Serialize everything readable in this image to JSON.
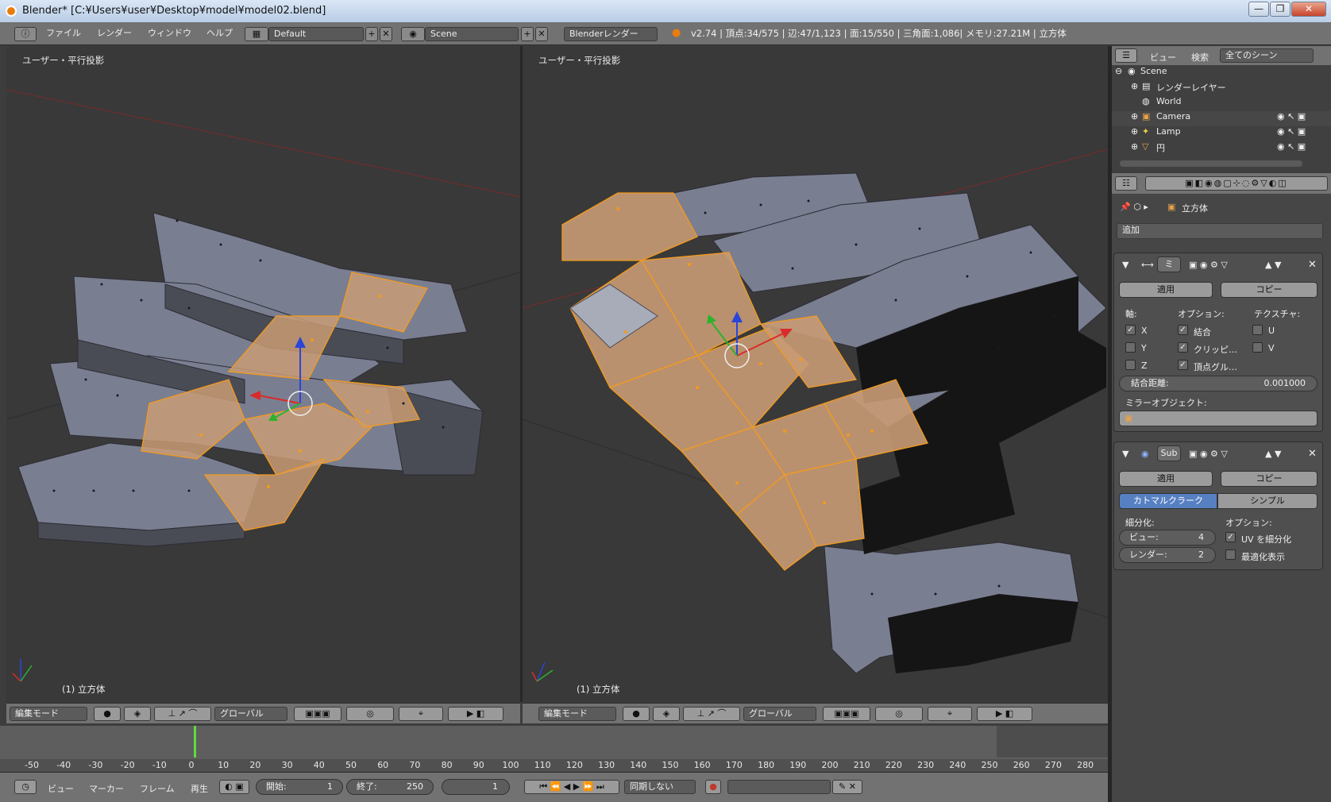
{
  "window": {
    "title": "Blender* [C:¥Users¥user¥Desktop¥model¥model02.blend]",
    "min": "—",
    "max": "❐",
    "close": "✕"
  },
  "info": {
    "menus": [
      "ファイル",
      "レンダー",
      "ウィンドウ",
      "ヘルプ"
    ],
    "layout": "Default",
    "scene": "Scene",
    "engine": "Blenderレンダー",
    "stats": "v2.74 | 頂点:34/575 | 辺:47/1,123 | 面:15/550 | 三角面:1,086| メモリ:27.21M | 立方体"
  },
  "viewport_left": {
    "label": "ユーザー・平行投影",
    "object": "(1) 立方体"
  },
  "viewport_right": {
    "label": "ユーザー・平行投影",
    "object": "(1) 立方体"
  },
  "view_header": {
    "mode": "編集モード",
    "orientation": "グローバル"
  },
  "outliner": {
    "menus": [
      "ビュー",
      "検索"
    ],
    "filter": "全てのシーン",
    "items": [
      {
        "name": "Scene",
        "icon": "scene-icon"
      },
      {
        "name": "レンダーレイヤー",
        "icon": "render-layers-icon"
      },
      {
        "name": "World",
        "icon": "world-icon"
      },
      {
        "name": "Camera",
        "icon": "camera-icon"
      },
      {
        "name": "Lamp",
        "icon": "lamp-icon"
      },
      {
        "name": "円",
        "icon": "mesh-icon"
      }
    ]
  },
  "properties": {
    "object_name": "立方体",
    "add_modifier": "追加",
    "mirror": {
      "name": "ミ",
      "apply": "適用",
      "copy": "コピー",
      "axis_label": "軸:",
      "options_label": "オプション:",
      "texture_label": "テクスチャ:",
      "axes": [
        {
          "label": "X",
          "checked": true
        },
        {
          "label": "Y",
          "checked": false
        },
        {
          "label": "Z",
          "checked": false
        }
      ],
      "options": [
        {
          "label": "結合",
          "checked": true
        },
        {
          "label": "クリッピ…",
          "checked": true
        },
        {
          "label": "頂点グル…",
          "checked": true
        }
      ],
      "textures": [
        {
          "label": "U",
          "checked": false
        },
        {
          "label": "V",
          "checked": false
        }
      ],
      "merge_label": "結合距離:",
      "merge_value": "0.001000",
      "mirror_object_label": "ミラーオブジェクト:"
    },
    "subsurf": {
      "name": "Sub",
      "apply": "適用",
      "copy": "コピー",
      "catmull": "カトマルクラーク",
      "simple": "シンプル",
      "subdiv_label": "細分化:",
      "options_label": "オプション:",
      "view_label": "ビュー:",
      "view_value": "4",
      "render_label": "レンダー:",
      "render_value": "2",
      "uv_label": "UV を細分化",
      "uv_checked": true,
      "optimal_label": "最適化表示",
      "optimal_checked": false
    }
  },
  "timeline": {
    "ticks": [
      "-50",
      "-40",
      "-30",
      "-20",
      "-10",
      "0",
      "10",
      "20",
      "30",
      "40",
      "50",
      "60",
      "70",
      "80",
      "90",
      "100",
      "110",
      "120",
      "130",
      "140",
      "150",
      "160",
      "170",
      "180",
      "190",
      "200",
      "210",
      "220",
      "230",
      "240",
      "250",
      "260",
      "270",
      "280"
    ],
    "current_frame": "1",
    "menus": [
      "ビュー",
      "マーカー",
      "フレーム",
      "再生"
    ],
    "start_label": "開始:",
    "start": "1",
    "end_label": "終了:",
    "end": "250",
    "sync": "同期しない"
  },
  "colors": {
    "selection": "#f39a1e",
    "face_selected": "#c99b74",
    "mesh_face": "#7b7f92",
    "bg": "#393939",
    "accent": "#5680c2"
  }
}
